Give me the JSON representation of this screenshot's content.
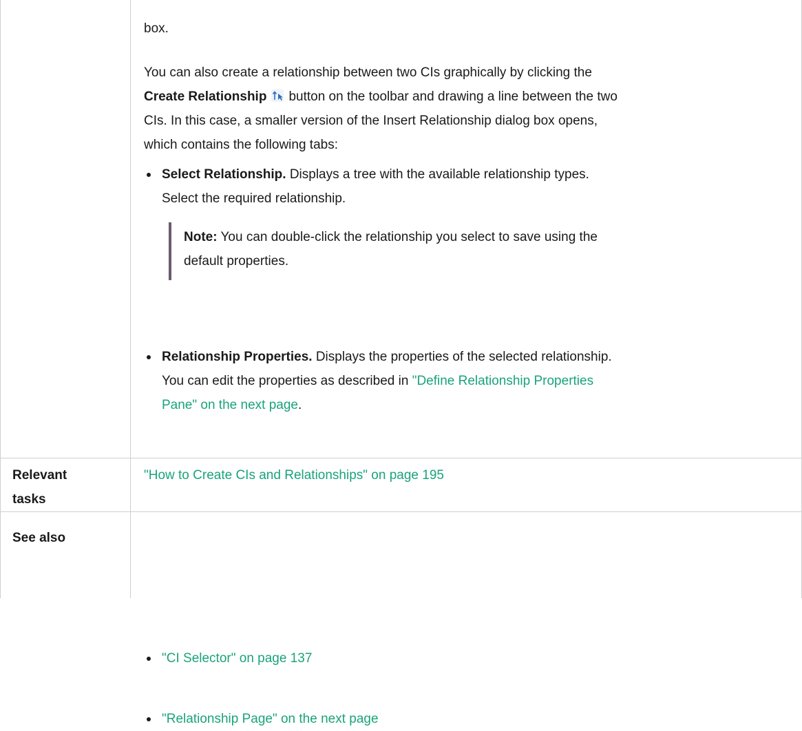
{
  "row_main": {
    "p_box": "box.",
    "p_also_1": "You can also create a relationship between two CIs graphically by clicking the",
    "p_also_bold": "Create Relationship",
    "p_also_2": "button on the toolbar and drawing a line between the two",
    "p_also_3": "CIs. In this case, a smaller version of the Insert Relationship dialog box opens,",
    "p_also_4": "which contains the following tabs:",
    "icon_name": "create-relationship-icon",
    "bullet1": {
      "bold": "Select Relationship.",
      "text1": "Displays a tree with the available relationship types.",
      "text2": "Select the required relationship."
    },
    "note": {
      "bold": "Note:",
      "text1": "You can double-click the relationship you select to save using the",
      "text2": "default properties."
    },
    "bullet2": {
      "bold": "Relationship Properties.",
      "text1": "Displays the properties of the selected relationship.",
      "text2": "You can edit the properties as described in",
      "link1": "\"Define Relationship Properties",
      "link2": "Pane\" on the next page",
      "end": "."
    }
  },
  "row_tasks": {
    "label1": "Relevant",
    "label2": "tasks",
    "link": "\"How to Create CIs and Relationships\" on page 195"
  },
  "row_see": {
    "label": "See also",
    "links": [
      "\"CI Selector\" on page 137",
      "\"Relationship Page\" on the next page"
    ]
  },
  "colors": {
    "link": "#1aa37a",
    "border": "#cfcfcf",
    "note_bar": "#6b5a70"
  }
}
